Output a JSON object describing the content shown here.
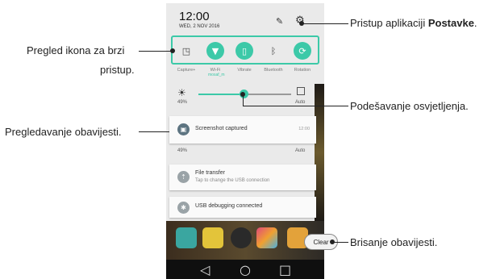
{
  "status": {
    "time": "12:00",
    "date": "WED, 2 NOV 2016"
  },
  "quick_settings": [
    {
      "label": "Capture+",
      "sub": "",
      "icon": "capture-plus-icon",
      "on": false,
      "glyph": "◳"
    },
    {
      "label": "Wi-Fi",
      "sub": "mosaf_m",
      "icon": "wifi-icon",
      "on": true,
      "glyph": "▼"
    },
    {
      "label": "Vibrate",
      "sub": "",
      "icon": "vibrate-icon",
      "on": true,
      "glyph": "▯"
    },
    {
      "label": "Bluetooth",
      "sub": "",
      "icon": "bluetooth-icon",
      "on": false,
      "glyph": "ᛒ"
    },
    {
      "label": "Rotation",
      "sub": "",
      "icon": "rotation-icon",
      "on": true,
      "glyph": "⟳"
    }
  ],
  "brightness": {
    "percent_label": "49%",
    "level_percent": 49,
    "auto_label": "Auto"
  },
  "notifications": [
    {
      "title": "Screenshot captured",
      "subtitle": "",
      "time": "12:00",
      "icon": "image-icon"
    },
    {
      "title": "File transfer",
      "subtitle": "Tap to change the USB connection",
      "time": "",
      "icon": "usb-icon"
    },
    {
      "title": "USB debugging connected",
      "subtitle": "",
      "time": "",
      "icon": "android-icon"
    }
  ],
  "overlap": {
    "percent_label": "49%",
    "auto_label": "Auto"
  },
  "clear_label": "Clear",
  "callouts": {
    "settings_prefix": "Pristup aplikaciji ",
    "settings_bold": "Postavke",
    "settings_suffix": ".",
    "quick_line1": "Pregled ikona za brzi",
    "quick_line2": "pristup.",
    "brightness": "Podešavanje osvjetljenja.",
    "notifications": "Pregledavanje obavijesti.",
    "clear": "Brisanje obavijesti."
  },
  "colors": {
    "accent": "#3cc9a8"
  }
}
